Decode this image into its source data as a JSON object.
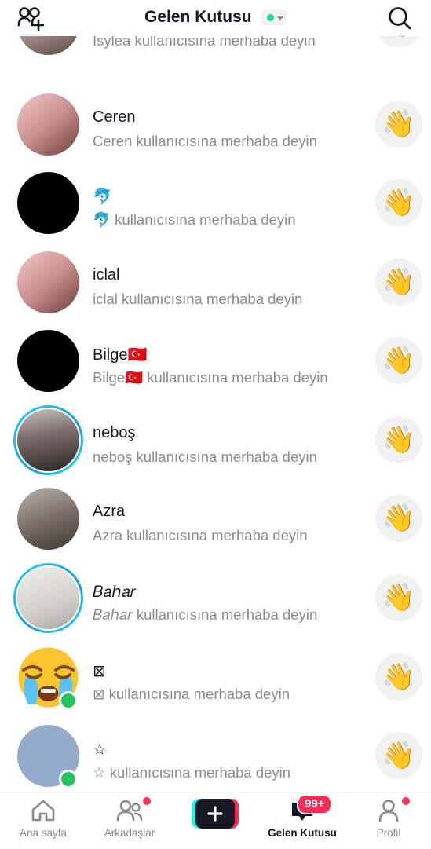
{
  "header": {
    "title": "Gelen Kutusu",
    "status_color": "#20d5a0",
    "add_friends_icon": "add-friends-icon",
    "search_icon": "search-icon"
  },
  "conversations": [
    {
      "name": "",
      "subtitle": "Isylea kullanıcısına merhaba deyin",
      "avatar": "photo",
      "story": false,
      "online": false
    },
    {
      "name": "Ceren",
      "subtitle": "Ceren kullanıcısına merhaba deyin",
      "avatar": "photo2",
      "story": false,
      "online": false
    },
    {
      "name": "🐬",
      "subtitle": "🐬 kullanıcısına merhaba deyin",
      "avatar": "black",
      "story": false,
      "online": false
    },
    {
      "name": "iclal",
      "subtitle": "iclal kullanıcısına merhaba deyin",
      "avatar": "photo2",
      "story": false,
      "online": false
    },
    {
      "name": "Bilge🇹🇷",
      "subtitle": "Bilge🇹🇷 kullanıcısına merhaba deyin",
      "avatar": "black",
      "story": false,
      "online": false
    },
    {
      "name": "neboş",
      "subtitle": "neboş kullanıcısına merhaba deyin",
      "avatar": "photo3",
      "story": true,
      "online": false
    },
    {
      "name": "Azra",
      "subtitle": "Azra kullanıcısına merhaba deyin",
      "avatar": "photo4",
      "story": false,
      "online": false
    },
    {
      "name": "𝐵𝑎ℎ𝑎𝑟",
      "subtitle": "𝐵𝑎ℎ𝑎𝑟 kullanıcısına merhaba deyin",
      "avatar": "photo5",
      "story": true,
      "online": false
    },
    {
      "name": "⊠",
      "subtitle": "⊠ kullanıcısına merhaba deyin",
      "avatar": "emoji",
      "story": false,
      "online": true
    },
    {
      "name": "☆",
      "subtitle": "☆ kullanıcısına merhaba deyin",
      "avatar": "blue-gray",
      "story": false,
      "online": true
    }
  ],
  "wave_icon": "👋",
  "bottom_nav": {
    "home": "Ana sayfa",
    "friends": "Arkadaşlar",
    "inbox": "Gelen Kutusu",
    "profile": "Profil",
    "inbox_badge": "99+",
    "accent": "#fe2c55"
  }
}
